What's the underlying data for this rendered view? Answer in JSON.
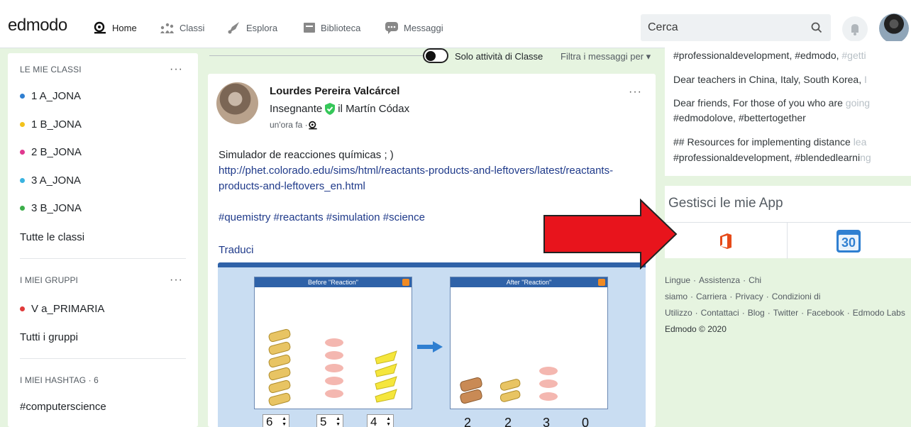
{
  "header": {
    "logo": "edmodo",
    "nav": [
      {
        "label": "Home",
        "icon": "home-icon"
      },
      {
        "label": "Classi",
        "icon": "classes-icon"
      },
      {
        "label": "Esplora",
        "icon": "explore-icon"
      },
      {
        "label": "Biblioteca",
        "icon": "library-icon"
      },
      {
        "label": "Messaggi",
        "icon": "messages-icon"
      }
    ],
    "search_placeholder": "Cerca"
  },
  "sidebar": {
    "classes_heading": "LE MIE CLASSI",
    "classes": [
      {
        "label": "1 A_JONA",
        "color": "#2f7fd1"
      },
      {
        "label": "1 B_JONA",
        "color": "#f2c21b"
      },
      {
        "label": "2 B_JONA",
        "color": "#e0388f"
      },
      {
        "label": "3 A_JONA",
        "color": "#3ab3e0"
      },
      {
        "label": "3 B_JONA",
        "color": "#3cae4a"
      }
    ],
    "all_classes": "Tutte le classi",
    "groups_heading": "I MIEI GRUPPI",
    "groups": [
      {
        "label": "V a_PRIMARIA",
        "color": "#e03a3a"
      }
    ],
    "all_groups": "Tutti i gruppi",
    "hashtags_heading": "I MIEI HASHTAG · 6",
    "hashtags": [
      "#computerscience"
    ],
    "more_label": "···"
  },
  "feed": {
    "toggle_label": "Solo attività di Classe",
    "filter_label": "Filtra i messaggi per ▾",
    "post": {
      "author": "Lourdes Pereira Valcárcel",
      "role": "Insegnante",
      "school": "il Martín Códax",
      "time": "un'ora fa · ",
      "text": "Simulador de reacciones químicas ; )",
      "link": "http://phet.colorado.edu/sims/html/reactants-products-and-leftovers/latest/reactants-products-and-leftovers_en.html",
      "tags": "#quemistry #reactants #simulation #science",
      "translate": "Traduci",
      "menu": "···",
      "simulation": {
        "before_title": "Before \"Reaction\"",
        "after_title": "After \"Reaction\"",
        "before_counts": [
          "6",
          "5",
          "4"
        ],
        "after_counts": [
          "2",
          "2",
          "3",
          "0"
        ]
      }
    }
  },
  "right": {
    "trending": [
      {
        "main": "#professionaldevelopment, #edmodo, ",
        "fade": "#getti"
      },
      {
        "main": "Dear teachers in China, Italy, South Korea, ",
        "fade": "I"
      },
      {
        "main": "Dear friends, For those of you who are ",
        "fade": "going"
      },
      {
        "main": "#edmodolove, #bettertogether",
        "fade": ""
      },
      {
        "main": "## Resources for implementing distance ",
        "fade": "lea"
      },
      {
        "main": "#professionaldevelopment, #blendedlearni",
        "fade": "ng"
      }
    ],
    "apps_title": "Gestisci le mie App",
    "calendar_day": "30",
    "footer_links": [
      "Lingue",
      "Assistenza",
      "Chi siamo",
      "Carriera",
      "Privacy",
      "Condizioni di Utilizzo",
      "Contattaci",
      "Blog",
      "Twitter",
      "Facebook",
      "Edmodo Labs"
    ],
    "copyright": "Edmodo © 2020"
  },
  "colors": {
    "background": "#e6f4e0",
    "link": "#1f3a8a",
    "arrow": "#e8141c",
    "office": "#e64a19",
    "calendar": "#2f7fd1",
    "verified": "#35c759"
  }
}
